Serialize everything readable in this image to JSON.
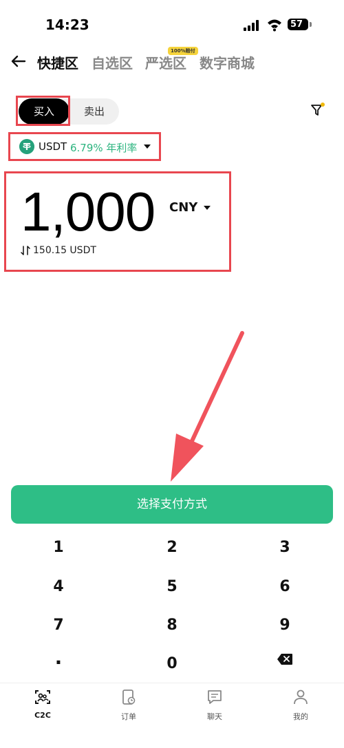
{
  "status": {
    "time": "14:23",
    "battery": "57"
  },
  "nav": {
    "tabs": [
      {
        "label": "快捷区"
      },
      {
        "label": "自选区"
      },
      {
        "label": "严选区"
      },
      {
        "label": "数字商城"
      }
    ],
    "badge": "100%赔付"
  },
  "trade": {
    "buy_label": "买入",
    "sell_label": "卖出"
  },
  "coin": {
    "name": "USDT",
    "rate": "6.79% 年利率"
  },
  "amount": {
    "value": "1,000",
    "currency": "CNY",
    "converted": "150.15 USDT"
  },
  "cta": {
    "label": "选择支付方式"
  },
  "keypad": {
    "keys": [
      "1",
      "2",
      "3",
      "4",
      "5",
      "6",
      "7",
      "8",
      "9",
      ".",
      "0"
    ]
  },
  "bottom_nav": {
    "items": [
      {
        "label": "C2C"
      },
      {
        "label": "订单"
      },
      {
        "label": "聊天"
      },
      {
        "label": "我的"
      }
    ]
  },
  "colors": {
    "accent": "#2ebe86",
    "highlight": "#e8464f",
    "usdt": "#26a17b"
  }
}
